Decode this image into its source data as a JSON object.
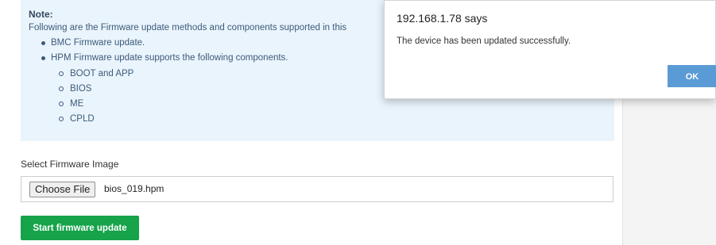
{
  "note": {
    "title": "Note:",
    "intro": "Following are the Firmware update methods and components supported in this",
    "items": [
      {
        "label": "BMC Firmware update."
      },
      {
        "label": "HPM Firmware update supports the following components.",
        "subitems": [
          "BOOT and APP",
          "BIOS",
          "ME",
          "CPLD"
        ]
      }
    ]
  },
  "firmware": {
    "select_label": "Select Firmware Image",
    "choose_label": "Choose File",
    "file_name": "bios_019.hpm",
    "start_label": "Start firmware update"
  },
  "dialog": {
    "title": "192.168.1.78 says",
    "message": "The device has been updated successfully.",
    "ok_label": "OK"
  },
  "colors": {
    "note_bg": "#eaf4fc",
    "start_button": "#16a34a",
    "ok_button": "#5b9bd5"
  }
}
